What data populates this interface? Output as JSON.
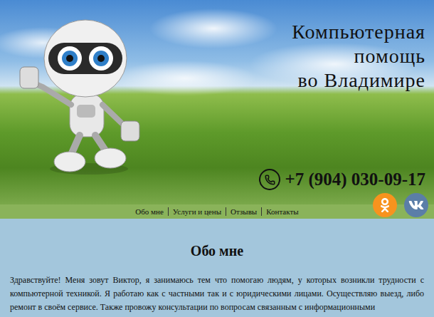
{
  "header": {
    "title_lines": [
      "Компьютерная",
      "помощь",
      "во Владимире"
    ],
    "phone": "+7 (904) 030-09-17"
  },
  "nav": {
    "items": [
      {
        "label": "Обо мне"
      },
      {
        "label": "Услуги и цены"
      },
      {
        "label": "Отзывы"
      },
      {
        "label": "Контакты"
      }
    ]
  },
  "social": [
    {
      "kind": "ok",
      "color": "#f7931e"
    },
    {
      "kind": "vk",
      "color": "#5b7ea8"
    }
  ],
  "section": {
    "heading": "Обо мне",
    "text": "Здравствуйте! Меня зовут Виктор, я занимаюсь тем что помогаю людям, у которых возникли трудности с компьютерной техникой. Я работаю как с частными так и с юридическими лицами. Осуществляю выезд, либо ремонт в своём сервисе. Также провожу консультации по вопросам связанным с информационными"
  }
}
